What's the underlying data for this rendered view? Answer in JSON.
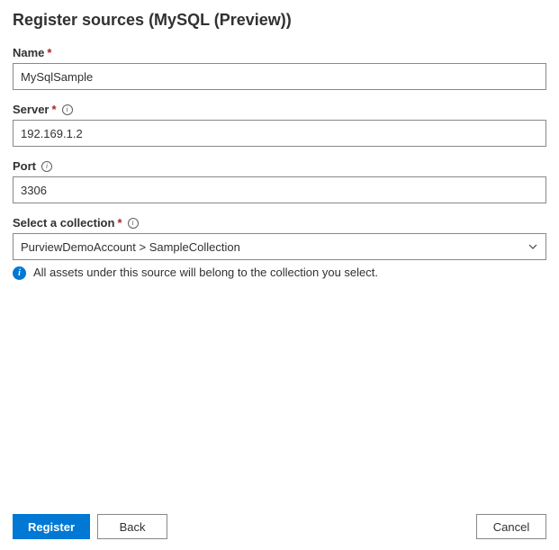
{
  "title": "Register sources (MySQL (Preview))",
  "fields": {
    "name": {
      "label": "Name",
      "value": "MySqlSample"
    },
    "server": {
      "label": "Server",
      "value": "192.169.1.2"
    },
    "port": {
      "label": "Port",
      "value": "3306"
    },
    "collection": {
      "label": "Select a collection",
      "value": "PurviewDemoAccount > SampleCollection",
      "helper": "All assets under this source will belong to the collection you select."
    }
  },
  "buttons": {
    "register": "Register",
    "back": "Back",
    "cancel": "Cancel"
  }
}
